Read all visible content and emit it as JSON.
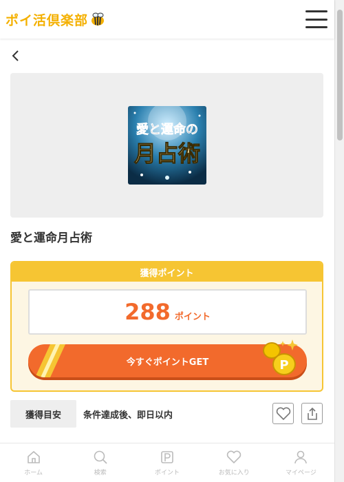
{
  "header": {
    "logo_text": "ポイ活倶楽部"
  },
  "offer": {
    "title": "愛と運命月占術",
    "thumbnail_text_line1": "愛と運命の",
    "thumbnail_text_line2": "月占術"
  },
  "points": {
    "header_label": "獲得ポイント",
    "value": "288",
    "unit": "ポイント",
    "cta_label": "今すぐポイントGET"
  },
  "info": {
    "label": "獲得目安",
    "value": "条件達成後、即日以内"
  },
  "nav": {
    "items": [
      {
        "label": "ホーム",
        "icon": "home-icon"
      },
      {
        "label": "検索",
        "icon": "search-icon"
      },
      {
        "label": "ポイント",
        "icon": "point-icon"
      },
      {
        "label": "お気に入り",
        "icon": "heart-icon"
      },
      {
        "label": "マイページ",
        "icon": "user-icon"
      }
    ]
  },
  "colors": {
    "accent_orange": "#f26a2c",
    "accent_yellow": "#f6c533",
    "logo_yellow": "#f4b000"
  }
}
